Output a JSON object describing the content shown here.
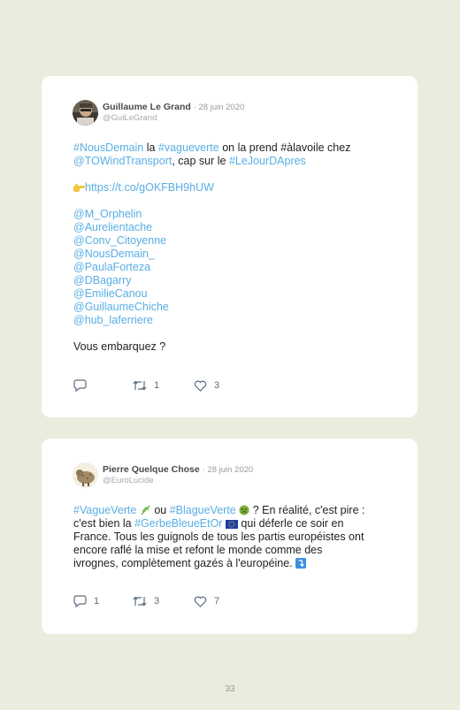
{
  "tweets": [
    {
      "author": "Guillaume Le Grand",
      "date": "· 28 juin 2020",
      "handle": "@GuiLeGrand",
      "text": {
        "l1a": "#NousDemain",
        "l1b": " la ",
        "l1c": "#vagueverte",
        "l1d": " on la prend #àlavoile chez",
        "l2a": "@TOWindTransport",
        "l2b": ", cap sur le ",
        "l2c": "#LeJourDApres",
        "link": "https://t.co/gOKFBH9hUW",
        "mentions": [
          "@M_Orphelin",
          "@Aurelientache",
          "@Conv_Citoyenne",
          "@NousDemain_",
          "@PaulaForteza",
          "@DBagarry",
          "@EmilieCanou",
          "@GuillaumeChiche",
          "@hub_laferriere"
        ],
        "closing": "Vous embarquez ?"
      },
      "retweets": "1",
      "likes": "3"
    },
    {
      "author": "Pierre Quelque Chose",
      "date": "· 28 juin 2020",
      "handle": "@EuroLucide",
      "text": {
        "l1a": "#VagueVerte",
        "l1b": " ou ",
        "l1c": "#BlagueVerte",
        "l1d": " ? En réalité, c'est pire :",
        "l2a": "c'est bien la ",
        "l2b": "#GerbeBleueEtOr",
        "l2c": " qui déferle ce soir en",
        "l3": "France. Tous les guignols de tous les partis européistes ont",
        "l4": "encore raflé la mise et refont le monde comme des",
        "l5": "ivrognes, complètement gazés à l'européine."
      },
      "replies": "1",
      "retweets": "3",
      "likes": "7"
    }
  ],
  "page_number": "33",
  "colors": {
    "link": "#58aee4",
    "background": "#e9edde",
    "card": "#ffffff"
  },
  "icons": [
    "reply-icon",
    "retweet-icon",
    "like-icon",
    "pointing-hand-icon",
    "herb-icon",
    "nauseated-face-icon",
    "eu-flag-icon",
    "arrow-down-icon"
  ]
}
